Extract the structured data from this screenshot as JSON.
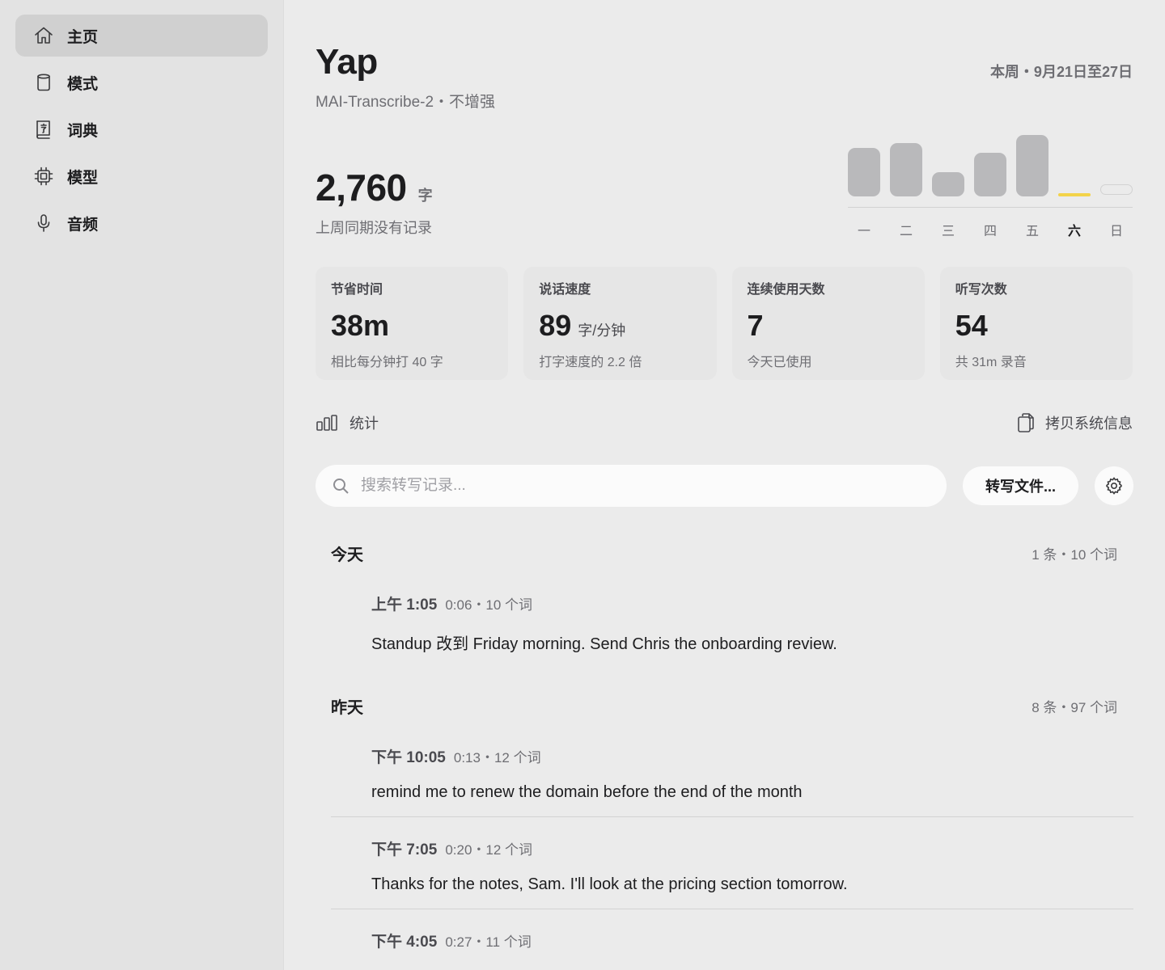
{
  "sidebar": {
    "items": [
      {
        "label": "主页",
        "icon": "home-icon",
        "active": true
      },
      {
        "label": "模式",
        "icon": "cylinder-icon",
        "active": false
      },
      {
        "label": "词典",
        "icon": "dictionary-icon",
        "active": false
      },
      {
        "label": "模型",
        "icon": "chip-icon",
        "active": false
      },
      {
        "label": "音频",
        "icon": "microphone-icon",
        "active": false
      }
    ]
  },
  "header": {
    "title": "Yap",
    "subtitle": "MAI-Transcribe-2・不增强",
    "week_range": "本周・9月21日至27日"
  },
  "summary": {
    "count": "2,760",
    "unit": "字",
    "compare": "上周同期没有记录"
  },
  "week_chart": {
    "days": [
      "一",
      "二",
      "三",
      "四",
      "五",
      "六",
      "日"
    ],
    "current_day_index": 5,
    "relative_values": [
      0.75,
      0.83,
      0.38,
      0.68,
      0.95,
      0.05,
      0
    ],
    "colors": {
      "bar": "#b9b9bb",
      "today": "#f3d34a"
    }
  },
  "cards": [
    {
      "label": "节省时间",
      "value": "38m",
      "unit": "",
      "note": "相比每分钟打 40 字"
    },
    {
      "label": "说话速度",
      "value": "89",
      "unit": "字/分钟",
      "note": "打字速度的 2.2 倍"
    },
    {
      "label": "连续使用天数",
      "value": "7",
      "unit": "",
      "note": "今天已使用"
    },
    {
      "label": "听写次数",
      "value": "54",
      "unit": "",
      "note": "共 31m 录音"
    }
  ],
  "toolbar": {
    "stats_label": "统计",
    "copy_label": "拷贝系统信息",
    "search_placeholder": "搜索转写记录...",
    "transcribe_label": "转写文件..."
  },
  "groups": [
    {
      "title": "今天",
      "meta": "1 条・10 个词",
      "records": [
        {
          "time": "上午 1:05",
          "info": "0:06・10 个词",
          "text": "Standup 改到 Friday morning. Send Chris the onboarding review."
        }
      ]
    },
    {
      "title": "昨天",
      "meta": "8 条・97 个词",
      "records": [
        {
          "time": "下午 10:05",
          "info": "0:13・12 个词",
          "text": "remind me to renew the domain before the end of the month"
        },
        {
          "time": "下午 7:05",
          "info": "0:20・12 个词",
          "text": "Thanks for the notes, Sam. I'll look at the pricing section tomorrow."
        },
        {
          "time": "下午 4:05",
          "info": "0:27・11 个词",
          "text": ""
        }
      ]
    }
  ]
}
